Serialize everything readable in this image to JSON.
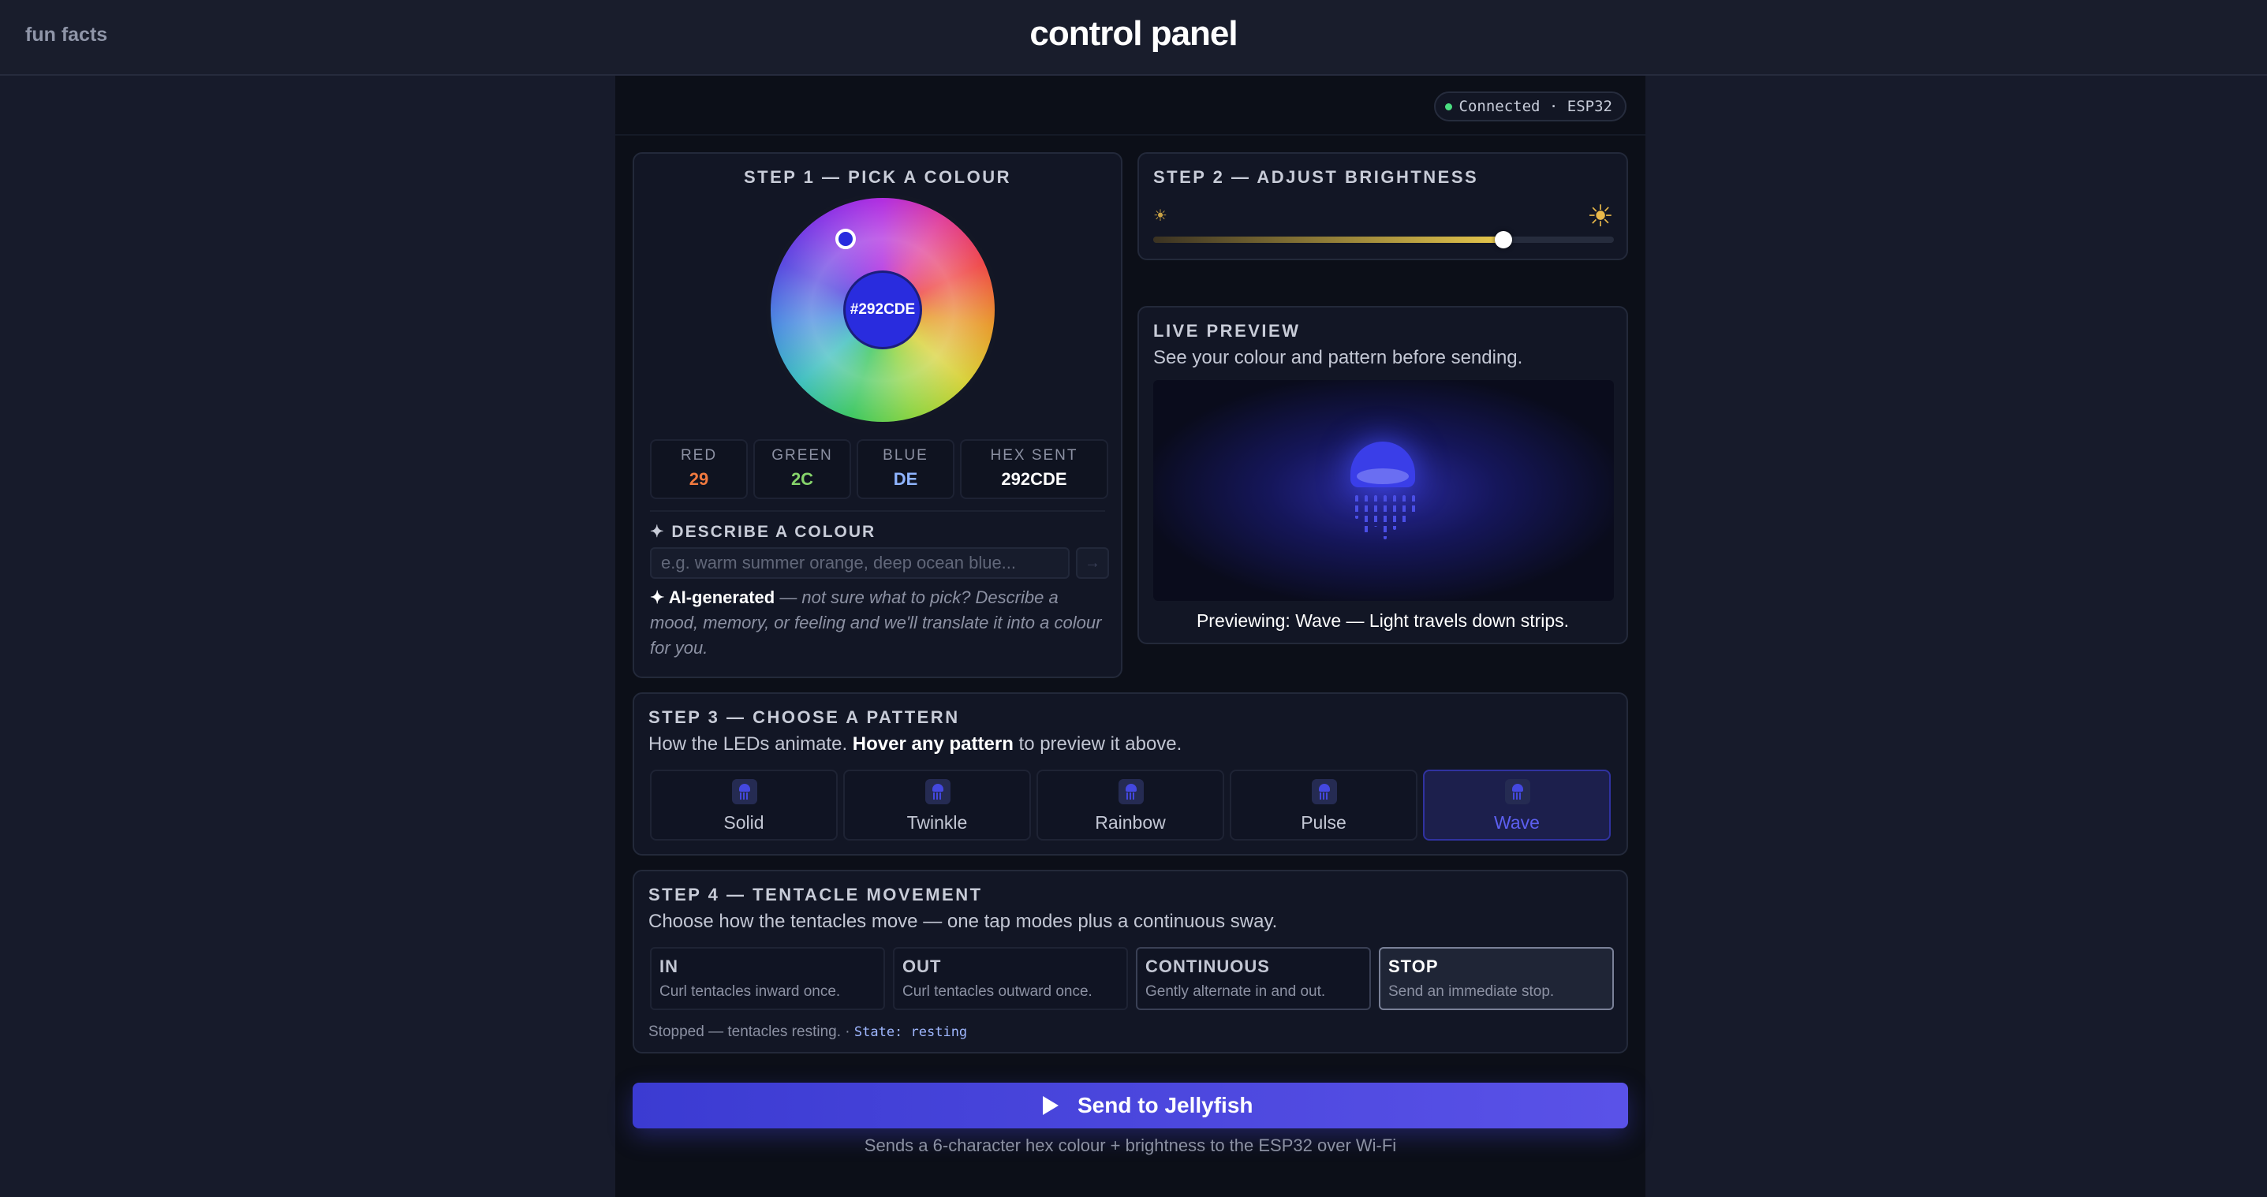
{
  "header": {
    "fun_facts": "fun facts",
    "title": "control panel"
  },
  "connection": {
    "text": "Connected · ESP32",
    "status_color": "#4ade80"
  },
  "step1": {
    "title": "STEP 1 — PICK A COLOUR",
    "hex_center": "#292CDE",
    "selected_color": "#292cde",
    "red_label": "RED",
    "red_value": "29",
    "red_color": "#f0793f",
    "green_label": "GREEN",
    "green_value": "2C",
    "green_color": "#86d46b",
    "blue_label": "BLUE",
    "blue_value": "DE",
    "blue_color": "#8fb4ff",
    "hex_label": "HEX SENT",
    "hex_value": "292CDE",
    "describe_title": "✦ DESCRIBE A COLOUR",
    "describe_placeholder": "e.g. warm summer orange, deep ocean blue...",
    "go_icon": "→",
    "ai_strong": "✦ AI-generated",
    "ai_note": " — not sure what to pick? Describe a mood, memory, or feeling and we'll translate it into a colour for you."
  },
  "step2": {
    "title": "STEP 2 — ADJUST BRIGHTNESS",
    "min_icon": "☀",
    "max_icon": "☀",
    "brightness_fraction": 0.76
  },
  "preview": {
    "title": "LIVE PREVIEW",
    "subtitle": "See your colour and pattern before sending.",
    "caption": "Previewing: Wave — Light travels down strips."
  },
  "step3": {
    "title": "STEP 3 — CHOOSE A PATTERN",
    "subtitle_a": "How the LEDs animate. ",
    "subtitle_b": "Hover any pattern",
    "subtitle_c": " to preview it above.",
    "patterns": [
      "Solid",
      "Twinkle",
      "Rainbow",
      "Pulse",
      "Wave"
    ],
    "selected": "Wave"
  },
  "step4": {
    "title": "STEP 4 — TENTACLE MOVEMENT",
    "subtitle": "Choose how the tentacles move — one tap modes plus a continuous sway.",
    "modes": [
      {
        "label": "IN",
        "desc": "Curl tentacles inward once."
      },
      {
        "label": "OUT",
        "desc": "Curl tentacles outward once."
      },
      {
        "label": "CONTINUOUS",
        "desc": "Gently alternate in and out."
      },
      {
        "label": "STOP",
        "desc": "Send an immediate stop."
      }
    ],
    "selected": "STOP",
    "status_text": "Stopped — tentacles resting.",
    "status_sep": " · ",
    "state_code": "State: resting"
  },
  "send": {
    "label": "Send to Jellyfish",
    "note": "Sends a 6-character hex colour + brightness to the ESP32 over Wi-Fi"
  }
}
